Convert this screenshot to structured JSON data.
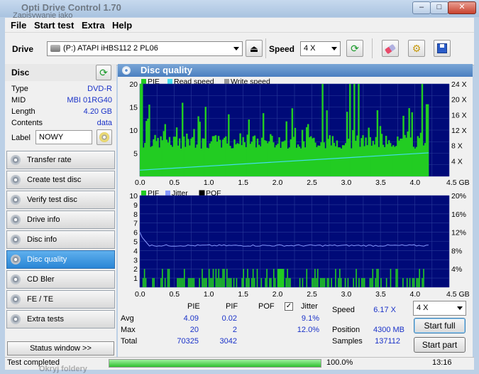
{
  "window": {
    "title": "Opti Drive Control 1.70",
    "subtitle": "Zapisywanie jako",
    "min": "–",
    "max": "□",
    "close": "✕"
  },
  "menu": {
    "file": "File",
    "start_test": "Start test",
    "extra": "Extra",
    "help": "Help"
  },
  "toolbar": {
    "drive_label": "Drive",
    "drive_value": "(P:)   ATAPI iHBS112   2 PL06",
    "speed_label": "Speed",
    "speed_value": "4 X"
  },
  "disc": {
    "header": "Disc",
    "rows": [
      {
        "k": "Type",
        "v": "DVD-R"
      },
      {
        "k": "MID",
        "v": "MBI 01RG40"
      },
      {
        "k": "Length",
        "v": "4.20 GB"
      },
      {
        "k": "Contents",
        "v": "data"
      }
    ],
    "label_key": "Label",
    "label_value": "NOWY"
  },
  "nav": [
    {
      "label": "Transfer rate",
      "active": false
    },
    {
      "label": "Create test disc",
      "active": false
    },
    {
      "label": "Verify test disc",
      "active": false
    },
    {
      "label": "Drive info",
      "active": false
    },
    {
      "label": "Disc info",
      "active": false
    },
    {
      "label": "Disc quality",
      "active": true
    },
    {
      "label": "CD Bler",
      "active": false
    },
    {
      "label": "FE / TE",
      "active": false
    },
    {
      "label": "Extra tests",
      "active": false
    }
  ],
  "status_window_btn": "Status window >>",
  "panel_title": "Disc quality",
  "chart_data": [
    {
      "type": "bar",
      "legend": [
        "PIE",
        "Read speed",
        "Write speed"
      ],
      "colors": {
        "pie": "#22cc22",
        "read": "#44ddee",
        "write": "#999999",
        "bg": "#000a78"
      },
      "xlim": [
        0,
        4.5
      ],
      "xunit": "GB",
      "x_ticks": [
        "0.0",
        "0.5",
        "1.0",
        "1.5",
        "2.0",
        "2.5",
        "3.0",
        "3.5",
        "4.0",
        "4.5 GB"
      ],
      "ylim": [
        0,
        20
      ],
      "y_ticks_left": [
        "20",
        "15",
        "10",
        "5"
      ],
      "y_ticks_right": [
        "24 X",
        "20 X",
        "16 X",
        "12 X",
        "8 X",
        "4 X"
      ],
      "pie_baseline": 6,
      "pie_max": 20,
      "read_speed_start_x": 1.6,
      "read_speed_end_x": 6.1,
      "data_end_gb": 4.2
    },
    {
      "type": "bar",
      "legend": [
        "PIF",
        "Jitter",
        "POF"
      ],
      "colors": {
        "pif": "#22cc22",
        "jitter": "#8899ff",
        "pof": "#000000",
        "bg": "#000a78"
      },
      "xlim": [
        0,
        4.5
      ],
      "x_ticks": [
        "0.0",
        "0.5",
        "1.0",
        "1.5",
        "2.0",
        "2.5",
        "3.0",
        "3.5",
        "4.0",
        "4.5 GB"
      ],
      "ylim": [
        0,
        10
      ],
      "y_ticks_left": [
        "10",
        "9",
        "8",
        "7",
        "6",
        "5",
        "4",
        "3",
        "2",
        "1"
      ],
      "y_ticks_right": [
        "20%",
        "16%",
        "12%",
        "8%",
        "4%"
      ],
      "jitter_percent": 9.1,
      "pif_max": 2,
      "data_end_gb": 4.2
    }
  ],
  "stats": {
    "col_pie": "PIE",
    "col_pif": "PIF",
    "col_pof": "POF",
    "col_jitter": "Jitter",
    "row_avg": "Avg",
    "row_max": "Max",
    "row_total": "Total",
    "avg_pie": "4.09",
    "avg_pif": "0.02",
    "avg_jitter": "9.1%",
    "max_pie": "20",
    "max_pif": "2",
    "max_jitter": "12.0%",
    "total_pie": "70325",
    "total_pif": "3042",
    "speed_label": "Speed",
    "speed_value": "6.17 X",
    "position_label": "Position",
    "position_value": "4300 MB",
    "samples_label": "Samples",
    "samples_value": "137112",
    "speed_select": "4 X",
    "start_full": "Start full",
    "start_part": "Start part"
  },
  "status": {
    "text": "Test completed",
    "percent": "100.0%",
    "time": "13:16",
    "progress": 1.0,
    "behind_text": "Okryj foldery"
  }
}
